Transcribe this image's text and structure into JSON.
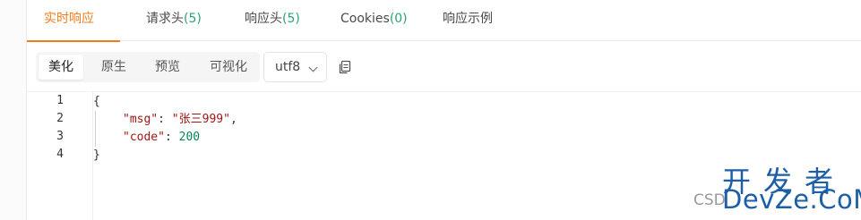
{
  "tabs": [
    {
      "label": "实时响应",
      "count": ""
    },
    {
      "label": "请求头",
      "count": "(5)"
    },
    {
      "label": "响应头",
      "count": "(5)"
    },
    {
      "label": "Cookies",
      "count": "(0)"
    },
    {
      "label": "响应示例",
      "count": ""
    }
  ],
  "active_tab": "实时响应",
  "view_modes": [
    "美化",
    "原生",
    "预览",
    "可视化"
  ],
  "active_view_mode": "美化",
  "encoding": "utf8",
  "icons": {
    "copy": "copy-icon",
    "dropdown": "chevron-down-icon"
  },
  "colors": {
    "accent": "#f07c1a",
    "count": "#2ba471",
    "json_key": "#a31515",
    "json_number": "#098658",
    "watermark": "#1d5ea8"
  },
  "code": {
    "line_numbers": [
      "1",
      "2",
      "3",
      "4"
    ],
    "open_brace": "{",
    "close_brace": "}",
    "fields": [
      {
        "key": "\"msg\"",
        "colon": ": ",
        "value": "\"张三999\"",
        "comma": ","
      },
      {
        "key": "\"code\"",
        "colon": ": ",
        "value": "200",
        "comma": ""
      }
    ]
  },
  "watermark": {
    "top": "开发者",
    "left_text": "CSD",
    "bottom": "DevZe.CoM"
  }
}
